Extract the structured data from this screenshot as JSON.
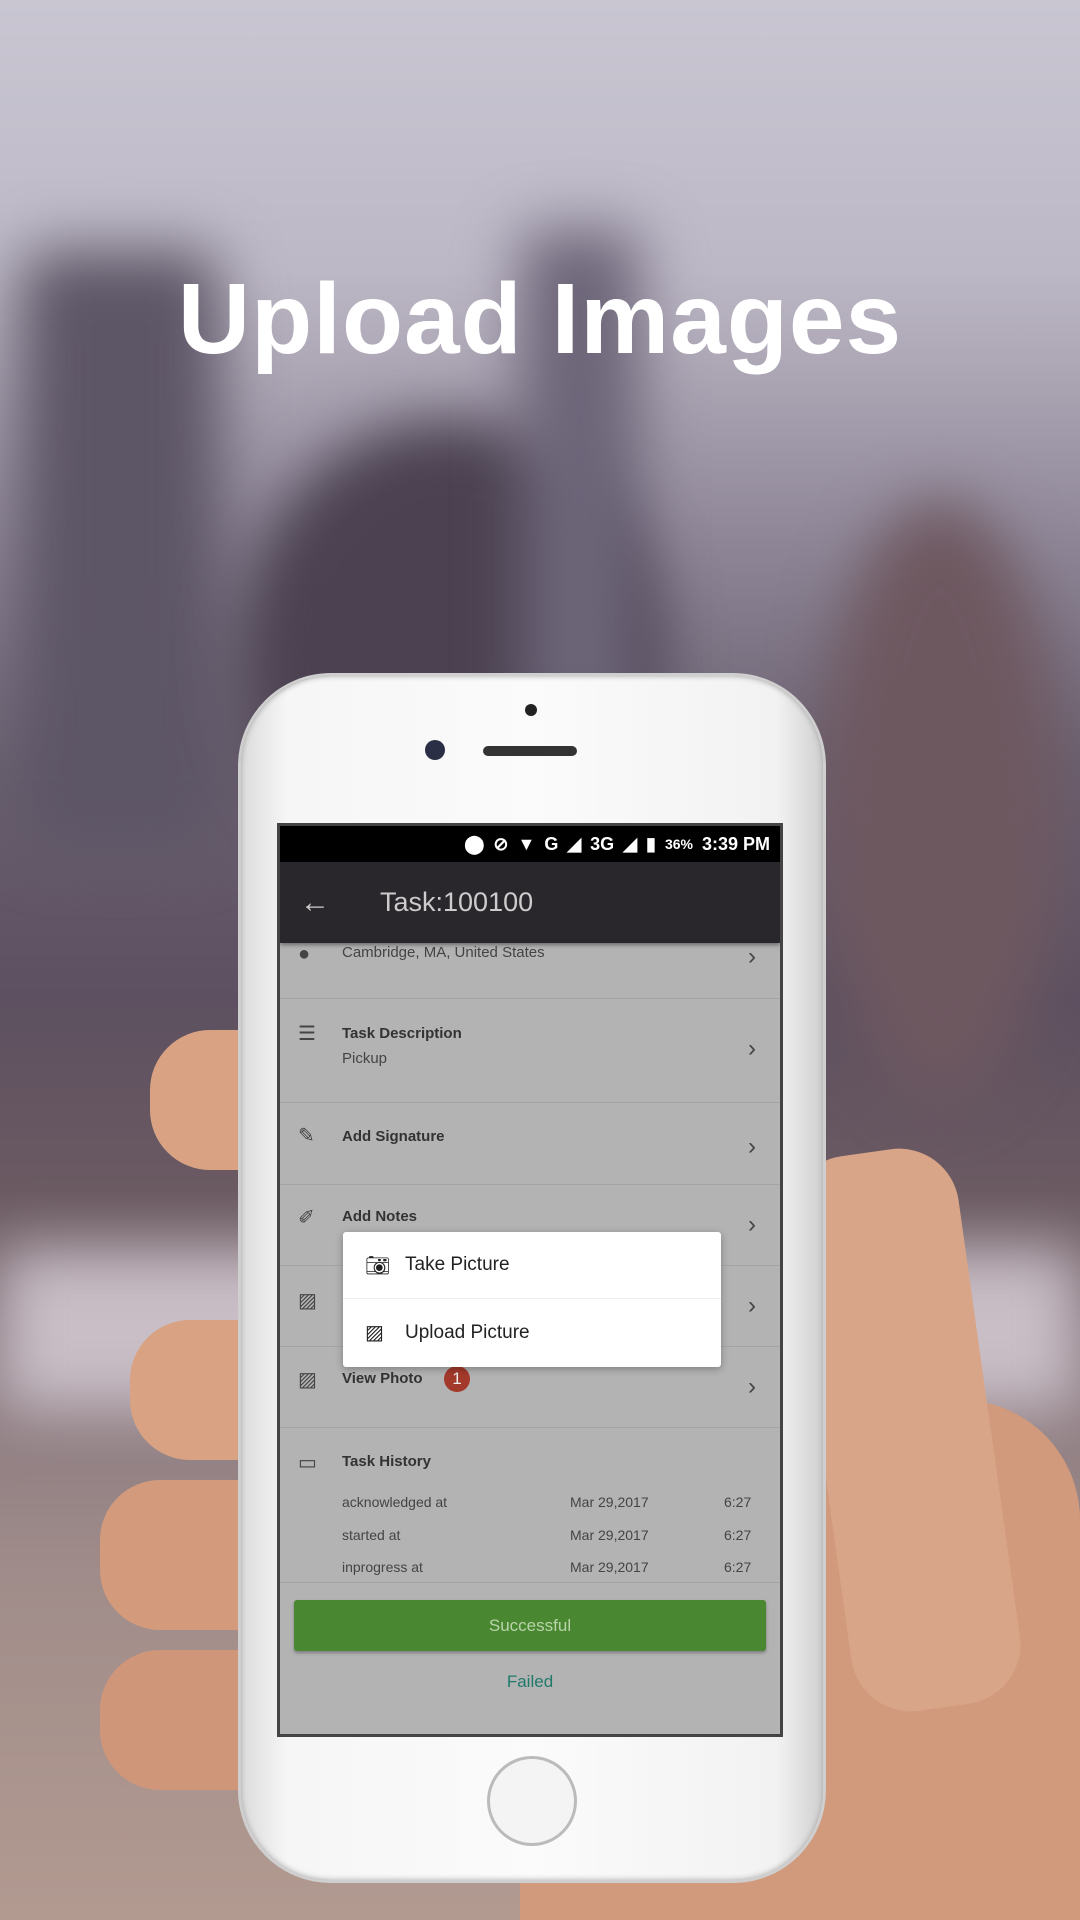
{
  "headline": "Upload Images",
  "status_bar": {
    "battery": "36%",
    "time": "3:39 PM",
    "network1": "G",
    "network2": "3G"
  },
  "app_bar": {
    "title": "Task:100100"
  },
  "rows": [
    {
      "label": "Cambridge, MA, United States",
      "icon": "location-pin-icon"
    },
    {
      "label": "Task Description",
      "sub": "Pickup",
      "icon": "list-icon"
    },
    {
      "label": "Add Signature",
      "icon": "pencil-icon"
    },
    {
      "label": "Add Notes",
      "icon": "edit-note-icon"
    },
    {
      "label": "",
      "icon": "image-icon"
    },
    {
      "label": "View Photo",
      "badge": "1",
      "icon": "photos-icon"
    }
  ],
  "popup": {
    "items": [
      {
        "label": "Take Picture",
        "icon": "camera-icon"
      },
      {
        "label": "Upload Picture",
        "icon": "image-icon"
      }
    ]
  },
  "history": {
    "title": "Task History",
    "rows": [
      {
        "event": "acknowledged at",
        "date": "Mar 29,2017",
        "time": "6:27"
      },
      {
        "event": "started at",
        "date": "Mar 29,2017",
        "time": "6:27"
      },
      {
        "event": "inprogress at",
        "date": "Mar 29,2017",
        "time": "6:27"
      }
    ]
  },
  "actions": {
    "success": "Successful",
    "failed": "Failed"
  },
  "colors": {
    "success": "#4a8731",
    "failed": "#1f7a6a",
    "badge": "#a3392b",
    "appbar": "#2a272c"
  }
}
